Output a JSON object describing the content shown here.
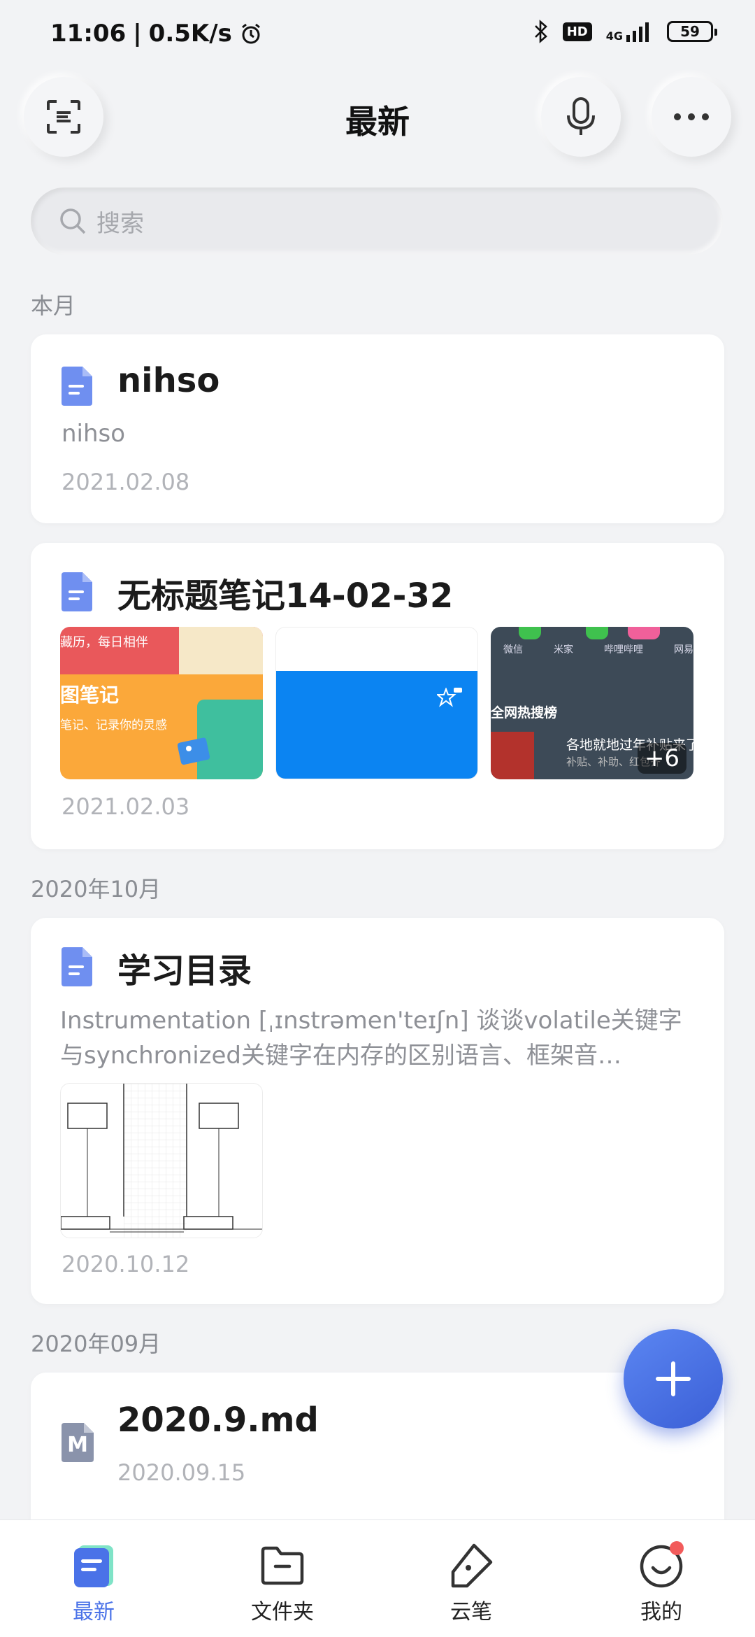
{
  "status_bar": {
    "time": "11:06",
    "separator": "|",
    "speed": "0.5K/s",
    "hd": "HD",
    "network": "4G",
    "battery": "59"
  },
  "header": {
    "title": "最新"
  },
  "search": {
    "placeholder": "搜索"
  },
  "sections": [
    {
      "label": "本月",
      "notes": [
        {
          "title": "nihso",
          "preview": "nihso",
          "date": "2021.02.08"
        },
        {
          "title": "无标题笔记14-02-32",
          "date": "2021.02.03",
          "more_images": "+6"
        }
      ]
    },
    {
      "label": "2020年10月",
      "notes": [
        {
          "title": "学习目录",
          "preview": "Instrumentation [ˌɪnstrəmen'teɪʃn] 谈谈volatile关键字与synchronized关键字在内存的区别语言、框架音…",
          "date": "2020.10.12"
        }
      ]
    },
    {
      "label": "2020年09月",
      "notes": [
        {
          "title": "2020.9.md",
          "date": "2020.09.15",
          "icon_letter": "M"
        }
      ]
    }
  ],
  "thumbnails": {
    "t1_line1": "藏历，每日相伴",
    "t1_line2": "图笔记",
    "t1_line3": "笔记、记录你的灵感",
    "t3_apps": [
      "微信",
      "米家",
      "哔哩哔哩",
      "网易"
    ],
    "t3_header": "全网热搜榜",
    "t3_headline": "各地就地过年补贴来了",
    "t3_sub": "补贴、补助、红包齐"
  },
  "bottom_nav": [
    {
      "label": "最新",
      "icon": "note-icon",
      "active": true
    },
    {
      "label": "文件夹",
      "icon": "folder-icon",
      "active": false
    },
    {
      "label": "云笔",
      "icon": "pen-icon",
      "active": false
    },
    {
      "label": "我的",
      "icon": "profile-icon",
      "active": false
    }
  ],
  "colors": {
    "accent": "#4a72e8",
    "background": "#f2f3f5",
    "note_icon": "#6f8ff0"
  }
}
